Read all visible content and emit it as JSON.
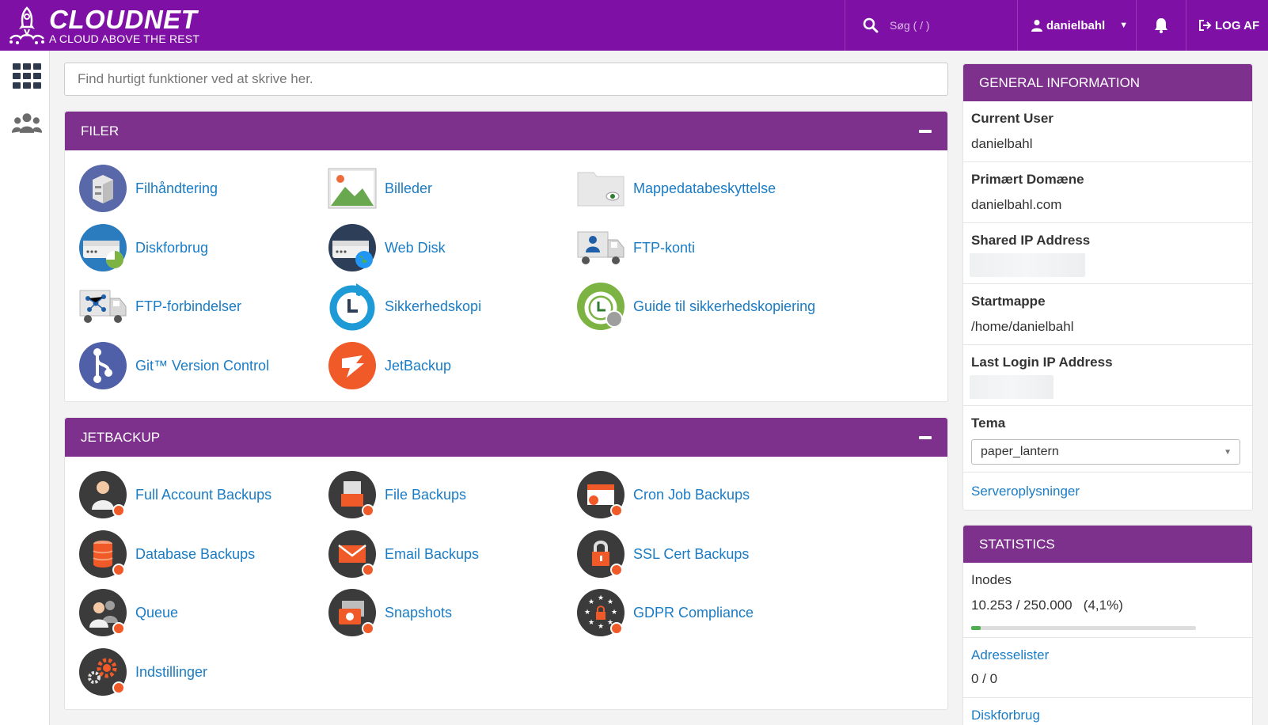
{
  "header": {
    "brand_name": "CLOUDNET",
    "brand_tagline": "A CLOUD ABOVE THE REST",
    "search_placeholder": "Søg ( / )",
    "username": "danielbahl",
    "logout_label": "LOG AF",
    "bg_color": "#7f10a6"
  },
  "rail": {
    "items": [
      {
        "icon": "apps-grid-icon"
      },
      {
        "icon": "users-icon"
      }
    ]
  },
  "quick_search": {
    "placeholder": "Find hurtigt funktioner ved at skrive her."
  },
  "sections": [
    {
      "title": "FILER",
      "items": [
        {
          "label": "Filhåndtering",
          "icon": "file-manager-icon"
        },
        {
          "label": "Billeder",
          "icon": "images-icon"
        },
        {
          "label": "Mappedatabeskyttelse",
          "icon": "directory-privacy-icon"
        },
        {
          "label": "Diskforbrug",
          "icon": "disk-usage-icon"
        },
        {
          "label": "Web Disk",
          "icon": "web-disk-icon"
        },
        {
          "label": "FTP-konti",
          "icon": "ftp-accounts-icon"
        },
        {
          "label": "FTP-forbindelser",
          "icon": "ftp-connections-icon"
        },
        {
          "label": "Sikkerhedskopi",
          "icon": "backup-icon"
        },
        {
          "label": "Guide til sikkerhedskopiering",
          "icon": "backup-wizard-icon"
        },
        {
          "label": "Git™ Version Control",
          "icon": "git-icon"
        },
        {
          "label": "JetBackup",
          "icon": "jetbackup-icon"
        }
      ]
    },
    {
      "title": "JETBACKUP",
      "items": [
        {
          "label": "Full Account Backups",
          "icon": "full-account-backups-icon"
        },
        {
          "label": "File Backups",
          "icon": "file-backups-icon"
        },
        {
          "label": "Cron Job Backups",
          "icon": "cron-job-backups-icon"
        },
        {
          "label": "Database Backups",
          "icon": "database-backups-icon"
        },
        {
          "label": "Email Backups",
          "icon": "email-backups-icon"
        },
        {
          "label": "SSL Cert Backups",
          "icon": "ssl-cert-backups-icon"
        },
        {
          "label": "Queue",
          "icon": "queue-icon"
        },
        {
          "label": "Snapshots",
          "icon": "snapshots-icon"
        },
        {
          "label": "GDPR Compliance",
          "icon": "gdpr-compliance-icon"
        },
        {
          "label": "Indstillinger",
          "icon": "settings-icon"
        }
      ]
    }
  ],
  "general_info": {
    "title": "GENERAL INFORMATION",
    "current_user_label": "Current User",
    "current_user": "danielbahl",
    "primary_domain_label": "Primært Domæne",
    "primary_domain": "danielbahl.com",
    "shared_ip_label": "Shared IP Address",
    "home_dir_label": "Startmappe",
    "home_dir": "/home/danielbahl",
    "last_login_label": "Last Login IP Address",
    "theme_label": "Tema",
    "theme_value": "paper_lantern",
    "server_info_link": "Serveroplysninger"
  },
  "statistics": {
    "title": "STATISTICS",
    "inodes_label": "Inodes",
    "inodes_value": "10.253 / 250.000",
    "inodes_percent": "(4,1%)",
    "inodes_fraction": 0.041,
    "address_lists_link": "Adresselister",
    "address_lists_value": "0 / 0",
    "disk_usage_link": "Diskforbrug"
  }
}
